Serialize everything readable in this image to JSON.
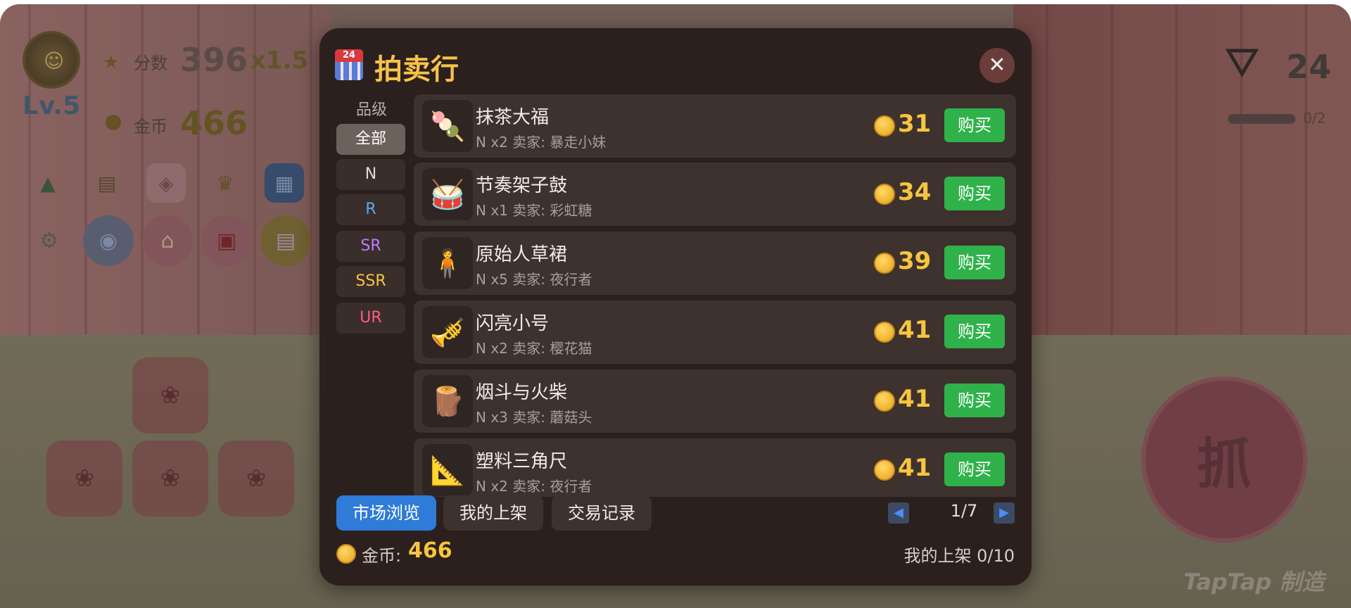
{
  "hud": {
    "level": "Lv.5",
    "score_label": "分数",
    "score_value": "396",
    "multiplier": "x1.5",
    "coin_label": "金币",
    "coin_value": "466",
    "claw_count": "24",
    "claw_progress": "0/2",
    "grab_label": "抓",
    "watermark": "TapTap 制造"
  },
  "modal": {
    "title": "拍卖行",
    "icon_badge": "24",
    "close_symbol": "✕",
    "filter": {
      "heading": "品级",
      "options": [
        "全部",
        "N",
        "R",
        "SR",
        "SSR",
        "UR"
      ],
      "active": "全部",
      "colors": [
        "#ffffff",
        "#e0dad6",
        "#5aa7ff",
        "#c07bff",
        "#f5c443",
        "#ff5c84"
      ]
    },
    "listings": [
      {
        "name": "抹茶大福",
        "meta": "N x2 卖家: 暴走小妹",
        "price": "31",
        "buy": "购买",
        "icon": "matcha-daifuku-icon",
        "glyph": "🍡"
      },
      {
        "name": "节奏架子鼓",
        "meta": "N x1 卖家: 彩虹糖",
        "price": "34",
        "buy": "购买",
        "icon": "drum-kit-icon",
        "glyph": "🥁"
      },
      {
        "name": "原始人草裙",
        "meta": "N x5 卖家: 夜行者",
        "price": "39",
        "buy": "购买",
        "icon": "caveman-grass-skirt-icon",
        "glyph": "🧍"
      },
      {
        "name": "闪亮小号",
        "meta": "N x2 卖家: 樱花猫",
        "price": "41",
        "buy": "购买",
        "icon": "trumpet-icon",
        "glyph": "🎺"
      },
      {
        "name": "烟斗与火柴",
        "meta": "N x3 卖家: 蘑菇头",
        "price": "41",
        "buy": "购买",
        "icon": "pipe-and-match-icon",
        "glyph": "🪵"
      },
      {
        "name": "塑料三角尺",
        "meta": "N x2 卖家: 夜行者",
        "price": "41",
        "buy": "购买",
        "icon": "triangle-ruler-icon",
        "glyph": "📐"
      }
    ],
    "tabs": [
      "市场浏览",
      "我的上架",
      "交易记录"
    ],
    "active_tab": "市场浏览",
    "pagination": {
      "prev": "◀",
      "next": "▶",
      "label": "1/7"
    },
    "footer": {
      "coin_label": "金币:",
      "coin_value": "466",
      "my_listings": "我的上架 0/10"
    }
  }
}
